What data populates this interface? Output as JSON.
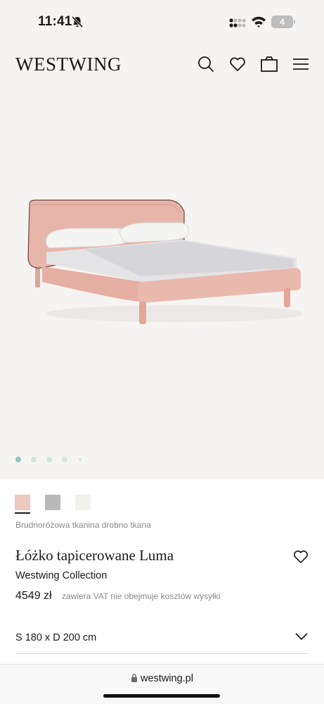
{
  "status_bar": {
    "time": "11:41",
    "battery": "4",
    "icons": [
      "bell-off-icon",
      "cellular-icon",
      "wifi-icon",
      "battery-icon"
    ]
  },
  "header": {
    "logo": "WESTWING",
    "icons": [
      "search-icon",
      "heart-icon",
      "bag-icon",
      "menu-icon"
    ]
  },
  "gallery": {
    "image": "pink-upholstered-bed",
    "slides_total": 5,
    "active_slide": 1
  },
  "colors": {
    "swatches": [
      {
        "name": "pink-swatch",
        "hex": "#edc9bf",
        "selected": true
      },
      {
        "name": "grey-swatch",
        "hex": "#b9b9b9",
        "selected": false
      },
      {
        "name": "white-swatch",
        "hex": "#f1f1ec",
        "selected": false
      }
    ],
    "selected_name": "Brudnoróżowa tkanina drobno tkana",
    "accent": "#8fc7bb"
  },
  "product": {
    "title": "Łóżko tapicerowane Luma",
    "brand": "Westwing Collection",
    "price": "4549 zł",
    "price_note": "zawiera VAT  nie obejmuje kosztów wysyłki"
  },
  "size": {
    "label": "S 180 x D 200 cm"
  },
  "browser": {
    "url": "westwing.pl"
  }
}
